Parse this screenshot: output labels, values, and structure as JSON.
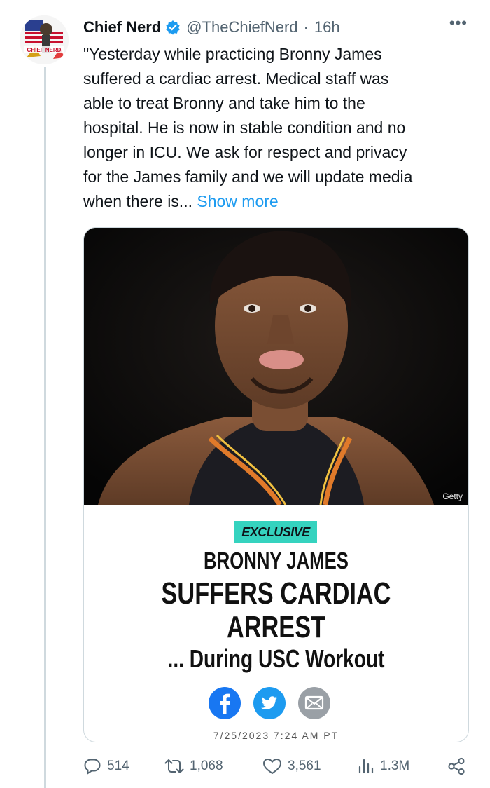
{
  "tweet": {
    "author_name": "Chief Nerd",
    "handle": "@TheChiefNerd",
    "separator": "·",
    "time_ago": "16h",
    "avatar_text": "CHIEF NERD",
    "more_label": "•••",
    "text_lines": [
      "\"Yesterday while practicing Bronny James",
      "suffered a cardiac arrest. Medical staff was",
      "able to treat Bronny and take him to the",
      "hospital. He is now in stable condition and no",
      "longer in ICU. We ask for respect and privacy",
      "for the James family and we will update media",
      "when there is..."
    ],
    "show_more_label": "Show more"
  },
  "card": {
    "photo_credit": "Getty",
    "badge": "EXCLUSIVE",
    "headline_1": "BRONNY JAMES",
    "headline_2": "SUFFERS CARDIAC",
    "headline_3": "ARREST",
    "headline_4": "... During USC Workout",
    "timestamp_partial": "7/25/2023 7:24 AM PT",
    "share_icons": [
      "facebook-icon",
      "twitter-icon",
      "email-icon"
    ]
  },
  "actions": {
    "replies": "514",
    "retweets": "1,068",
    "likes": "3,561",
    "views": "1.3M"
  },
  "colors": {
    "accent": "#1d9bf0",
    "badge": "#35d3bf",
    "muted": "#536471"
  }
}
